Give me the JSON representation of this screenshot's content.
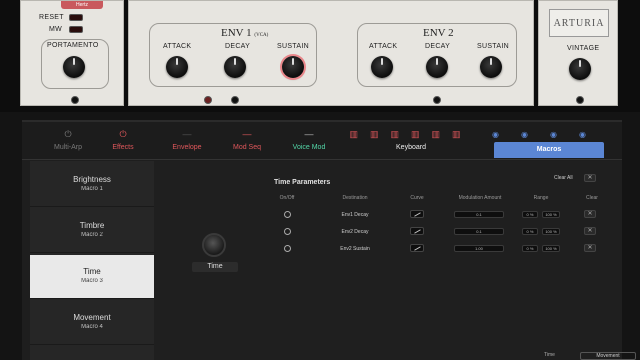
{
  "hw": {
    "left": {
      "pitch_display": "Hertz",
      "reset_label": "RESET",
      "mw_label": "MW",
      "portamento_label": "PORTAMENTO"
    },
    "env1": {
      "title": "ENV 1",
      "title_sub": "(VCA)",
      "attack_label": "ATTACK",
      "decay_label": "DECAY",
      "sustain_label": "SUSTAIN"
    },
    "env2": {
      "title": "ENV 2",
      "attack_label": "ATTACK",
      "decay_label": "DECAY",
      "sustain_label": "SUSTAIN"
    },
    "brand": {
      "logo": "ARTURIA",
      "vintage_label": "VINTAGE"
    }
  },
  "tabs": [
    {
      "label": "Multi-Arp",
      "icon": "power-icon",
      "color": "#7a7a7a"
    },
    {
      "label": "Effects",
      "icon": "power-icon",
      "color": "#e0575b"
    },
    {
      "label": "Envelope",
      "icon": "line-icon",
      "color": "#e0575b"
    },
    {
      "label": "Mod Seq",
      "icon": "line-icon",
      "color": "#e0575b"
    },
    {
      "label": "Voice Mod",
      "icon": "line-icon",
      "color": "#53d6a8"
    },
    {
      "label": "Keyboard",
      "icon": "keyboard-icon",
      "color": "#e0575b"
    },
    {
      "label": "Macros",
      "icon": "macro-icon",
      "color": "#5b86d4"
    }
  ],
  "macros": [
    {
      "name": "Brightness",
      "sub": "Macro 1"
    },
    {
      "name": "Timbre",
      "sub": "Macro 2"
    },
    {
      "name": "Time",
      "sub": "Macro 3"
    },
    {
      "name": "Movement",
      "sub": "Macro 4"
    }
  ],
  "editor": {
    "macro_knob_label": "Time",
    "params_title": "Time Parameters",
    "clear_all_label": "Clear All",
    "columns": {
      "onoff": "On/Off",
      "destination": "Destination",
      "curve": "Curve",
      "amount": "Modulation Amount",
      "range": "Range",
      "clear": "Clear"
    },
    "rows": [
      {
        "destination": "Env1 Decay",
        "amount": "0.1",
        "range_min": "0 %",
        "range_max": "100 %"
      },
      {
        "destination": "Env2 Decay",
        "amount": "0.1",
        "range_min": "0 %",
        "range_max": "100 %"
      },
      {
        "destination": "Env2 Sustain",
        "amount": "1.00",
        "range_min": "0 %",
        "range_max": "100 %"
      }
    ]
  },
  "footer": {
    "time_label": "Time",
    "movement_label": "Movement"
  }
}
